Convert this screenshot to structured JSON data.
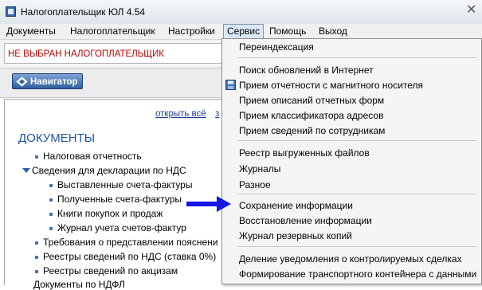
{
  "window": {
    "title": "Налогоплательщик ЮЛ 4.54",
    "close_glyph": "✕"
  },
  "menubar": {
    "items": [
      "Документы",
      "Налогоплательщик",
      "Настройки",
      "Сервис",
      "Помощь",
      "Выход"
    ],
    "active": "Сервис"
  },
  "status": {
    "warning": "НЕ ВЫБРАН НАЛОГОПЛАТЕЛЬЩИК"
  },
  "toolbar": {
    "navigator_label": "Навигатор"
  },
  "panel": {
    "link_open_all": "открыть всё",
    "link_next_partial": "з",
    "heading": "ДОКУМЕНТЫ",
    "tree": [
      "Налоговая отчетность",
      "Сведения для декларации по НДС",
      "Выставленные счета-фактуры",
      "Полученные счета-фактуры",
      "Книги покупок и продаж",
      "Журнал учета счетов-фактур",
      "Требования о представлении пояснени",
      "Реестры сведений по НДС (ставка 0%)",
      "Реестры сведений по акцизам",
      "Документы по НДФЛ"
    ]
  },
  "service_menu": {
    "items": [
      "Переиндексация",
      "Поиск обновлений в Интернет",
      "Прием отчетности с магнитного носителя",
      "Прием описаний отчетных форм",
      "Прием классификатора адресов",
      "Прием сведений по сотрудникам",
      "Реестр выгруженных файлов",
      "Журналы",
      "Разное",
      "Сохранение информации",
      "Восстановление информации",
      "Журнал резервных копий",
      "Деление уведомления о контролируемых сделках",
      "Формирование транспортного контейнера с данными"
    ]
  },
  "colors": {
    "accent_arrow": "#1616e6",
    "warning_text": "#c00000",
    "heading": "#1c55a6"
  }
}
